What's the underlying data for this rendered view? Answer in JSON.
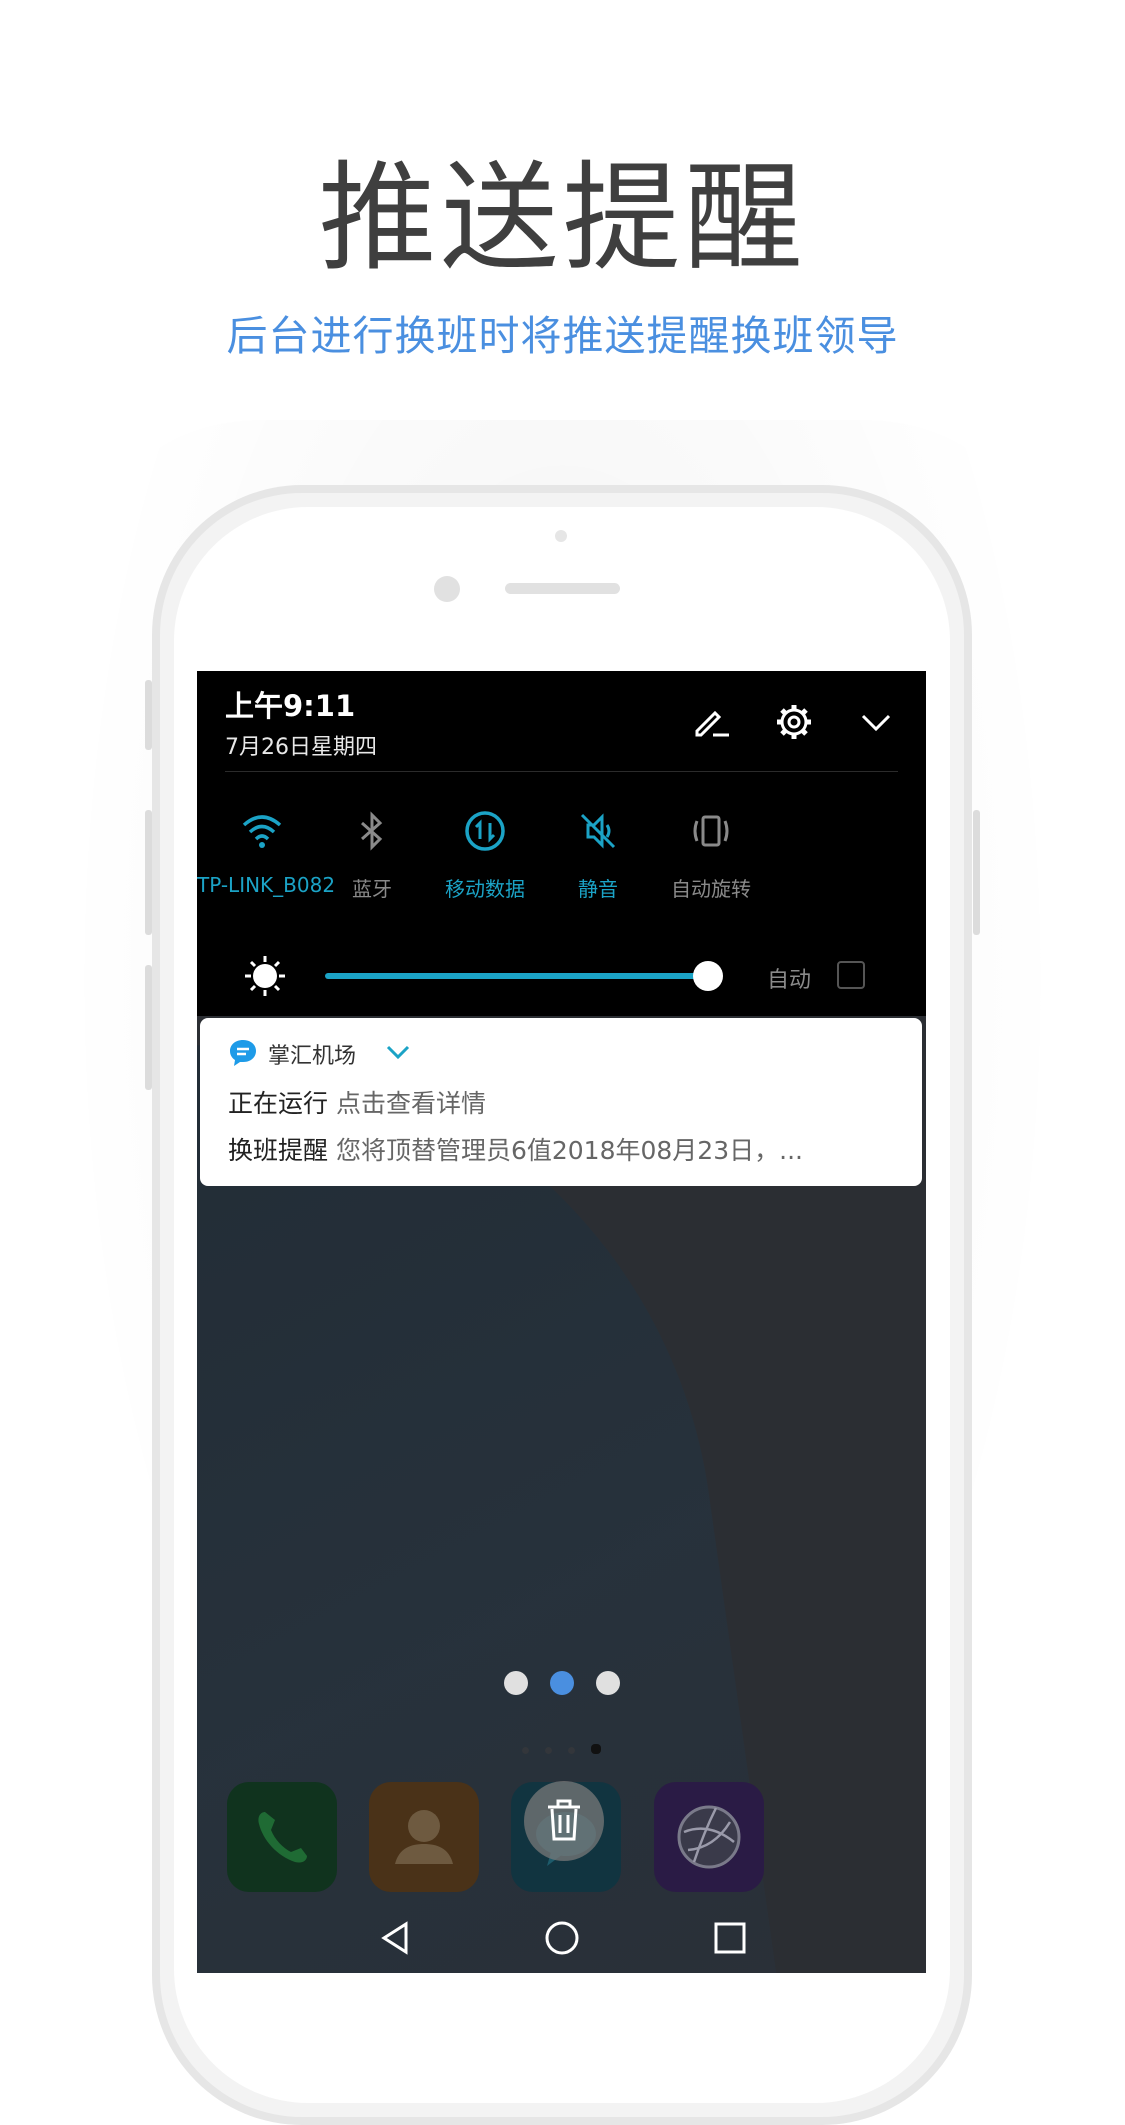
{
  "header": {
    "title": "推送提醒",
    "subtitle": "后台进行换班时将推送提醒换班领导"
  },
  "status": {
    "time": "上午9:11",
    "date": "7月26日星期四"
  },
  "header_icons": [
    "edit-icon",
    "gear-icon",
    "chevron-down-icon"
  ],
  "quick_settings": [
    {
      "label": "TP-LINK_B082",
      "icon": "wifi-icon",
      "active": true
    },
    {
      "label": "蓝牙",
      "icon": "bluetooth-icon",
      "active": false
    },
    {
      "label": "移动数据",
      "icon": "mobile-data-icon",
      "active": true
    },
    {
      "label": "静音",
      "icon": "mute-icon",
      "active": true
    },
    {
      "label": "自动旋转",
      "icon": "auto-rotate-icon",
      "active": false
    }
  ],
  "brightness": {
    "level": 0.97,
    "auto_label": "自动",
    "auto_checked": false
  },
  "notification": {
    "app_name": "掌汇机场",
    "line1_title": "正在运行",
    "line1_text": "点击查看详情",
    "line2_title": "换班提醒",
    "line2_text": "您将顶替管理员6值2018年08月23日，..."
  },
  "page_dots": {
    "count": 3,
    "active": 1
  },
  "dock": [
    "phone-icon",
    "contacts-icon",
    "messages-icon",
    "browser-icon"
  ],
  "nav": [
    "back-icon",
    "home-icon",
    "recents-icon"
  ],
  "colors": {
    "accent": "#1ba3c6",
    "subtitle": "#4a8fe0",
    "title": "#3f3f3f"
  }
}
